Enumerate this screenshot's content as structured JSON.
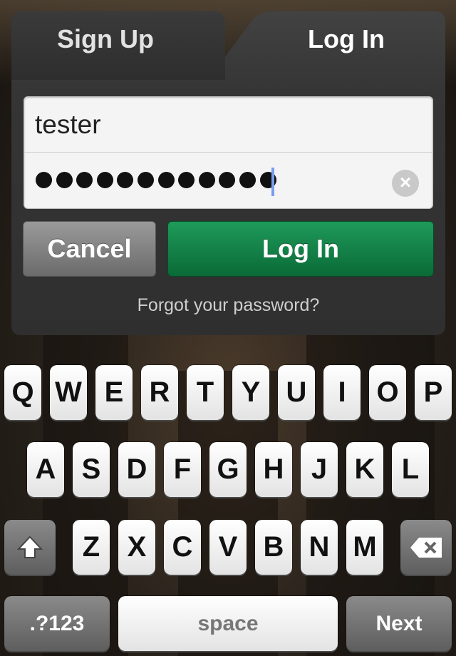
{
  "tabs": {
    "signup_label": "Sign Up",
    "login_label": "Log In"
  },
  "form": {
    "username_value": "tester",
    "password_masked_count": 12,
    "cancel_label": "Cancel",
    "login_label": "Log In",
    "forgot_label": "Forgot your password?"
  },
  "keyboard": {
    "row1": [
      "Q",
      "W",
      "E",
      "R",
      "T",
      "Y",
      "U",
      "I",
      "O",
      "P"
    ],
    "row2": [
      "A",
      "S",
      "D",
      "F",
      "G",
      "H",
      "J",
      "K",
      "L"
    ],
    "row3": [
      "Z",
      "X",
      "C",
      "V",
      "B",
      "N",
      "M"
    ],
    "numbers_label": ".?123",
    "space_label": "space",
    "next_label": "Next",
    "shift_icon": "shift-icon",
    "backspace_icon": "backspace-icon"
  },
  "colors": {
    "accent_green": "#0e7a40",
    "panel": "#333333"
  }
}
